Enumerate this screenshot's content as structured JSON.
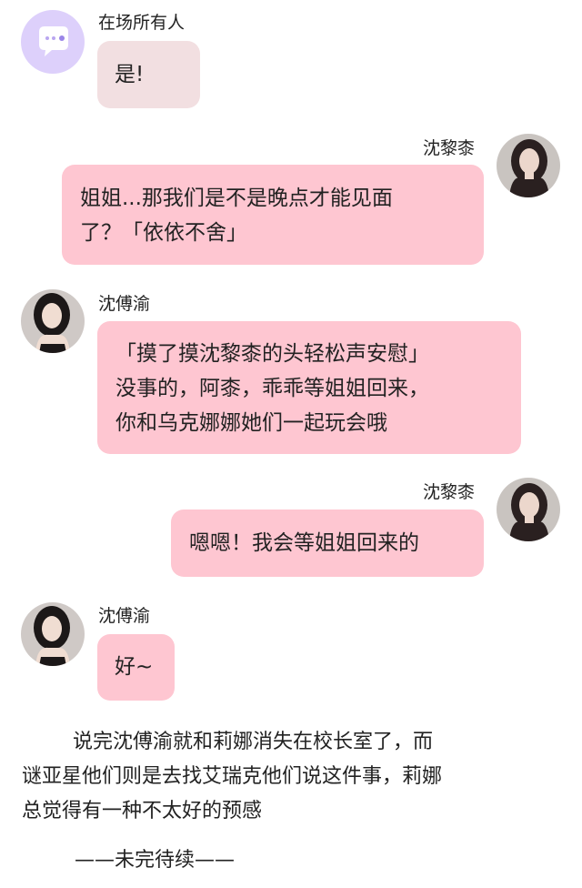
{
  "messages": [
    {
      "speaker": "在场所有人",
      "side": "left",
      "avatar": "group-chat-icon",
      "lines": [
        "是!"
      ]
    },
    {
      "speaker": "沈黎桼",
      "side": "right",
      "avatar": "female-portrait",
      "lines": [
        "姐姐...那我们是不是晚点才能见面",
        "了？「依依不舍」"
      ]
    },
    {
      "speaker": "沈傅渝",
      "side": "left",
      "avatar": "female-portrait",
      "lines": [
        "「摸了摸沈黎桼的头轻松声安慰」",
        "没事的，阿桼，乖乖等姐姐回来，",
        "你和乌克娜娜她们一起玩会哦"
      ]
    },
    {
      "speaker": "沈黎桼",
      "side": "right",
      "avatar": "female-portrait",
      "lines": [
        "嗯嗯！我会等姐姐回来的"
      ]
    },
    {
      "speaker": "沈傅渝",
      "side": "left",
      "avatar": "female-portrait",
      "lines": [
        "好~"
      ]
    }
  ],
  "narration": {
    "lines": [
      "说完沈傅渝就和莉娜消失在校长室了，而",
      "谜亚星他们则是去找艾瑞克他们说这件事，莉娜",
      "总觉得有一种不太好的预感"
    ],
    "ending": "——未完待续——"
  },
  "colors": {
    "group_avatar_bg": "#ddd0fb",
    "bubble_gray": "#f2dfe1",
    "bubble_pink": "#fec6d1"
  }
}
